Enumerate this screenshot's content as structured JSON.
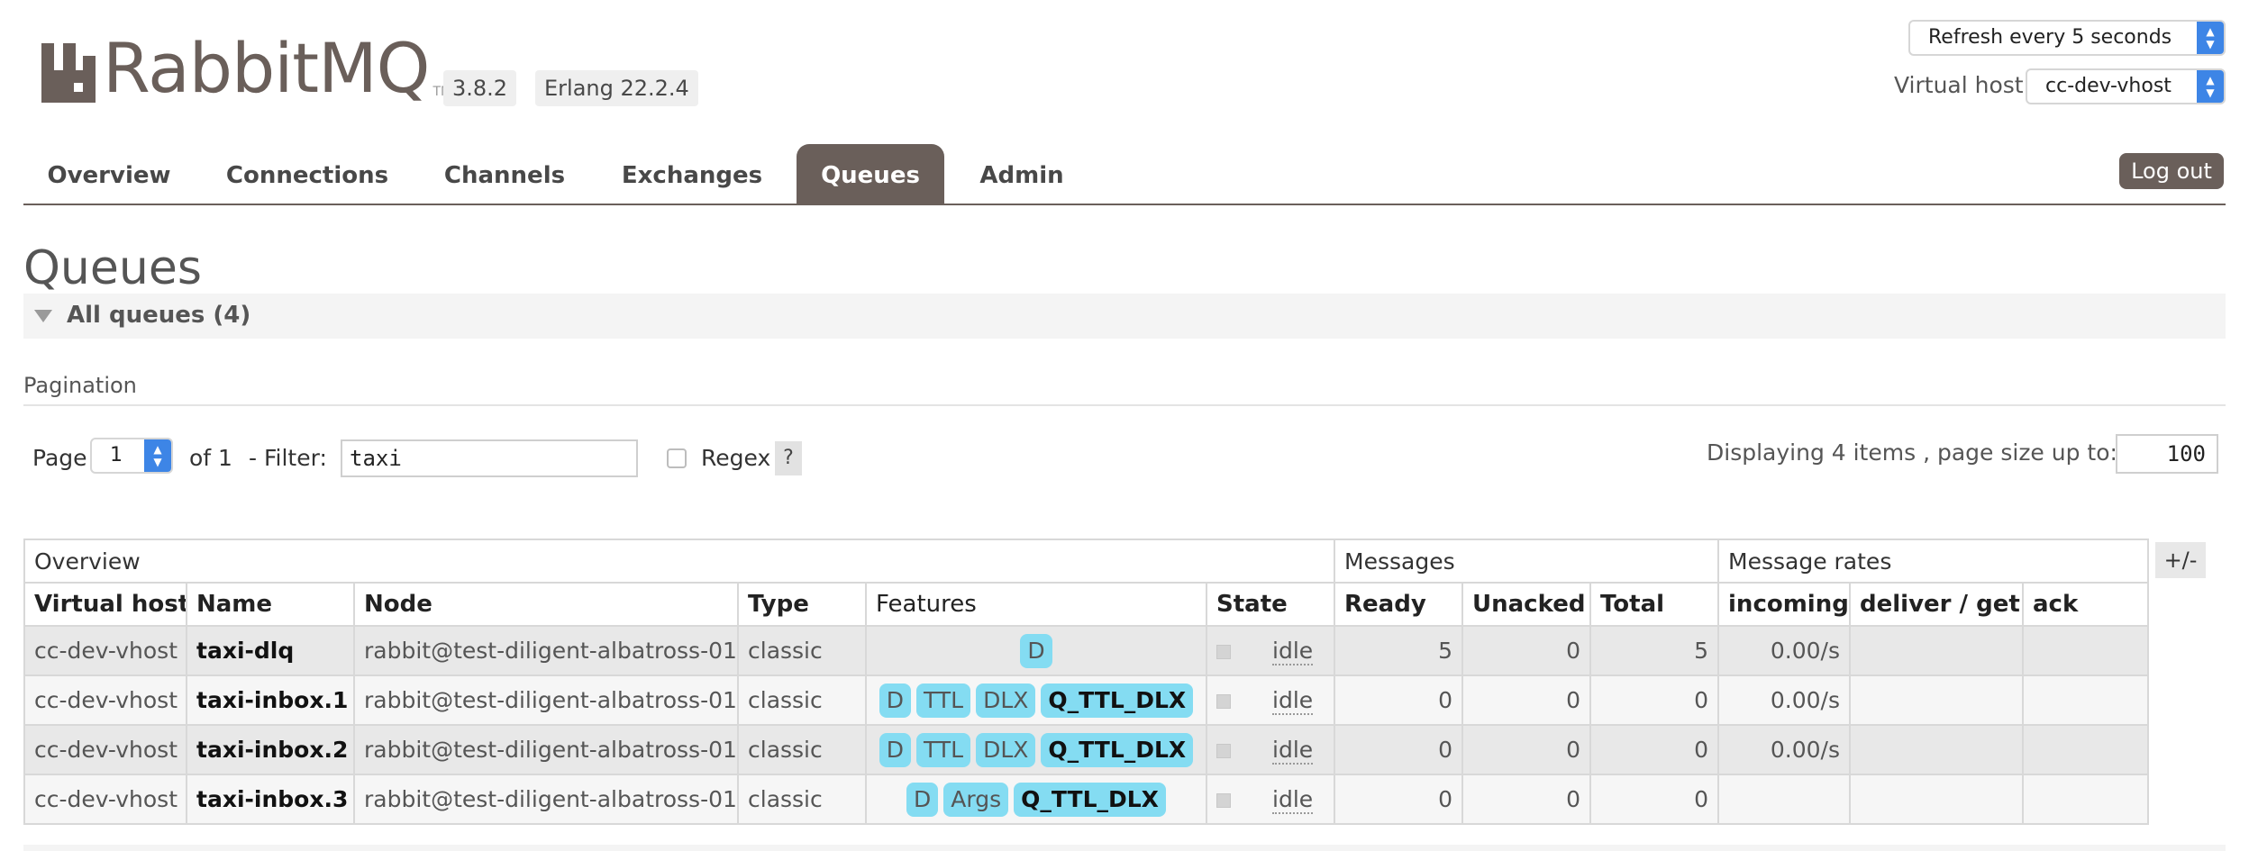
{
  "app": {
    "logo_text": "RabbitMQ",
    "logo_tm": "TM",
    "version": "3.8.2",
    "erlang": "Erlang 22.2.4",
    "refresh_select": "Refresh every 5 seconds",
    "vhost_label": "Virtual host",
    "vhost_select": "cc-dev-vhost",
    "logout": "Log out"
  },
  "nav": {
    "tabs": [
      {
        "label": "Overview",
        "active": false
      },
      {
        "label": "Connections",
        "active": false
      },
      {
        "label": "Channels",
        "active": false
      },
      {
        "label": "Exchanges",
        "active": false
      },
      {
        "label": "Queues",
        "active": true
      },
      {
        "label": "Admin",
        "active": false
      }
    ]
  },
  "page": {
    "title": "Queues",
    "section": "All queues (4)"
  },
  "pagination": {
    "label": "Pagination",
    "page_label": "Page",
    "page_value": "1",
    "of_label": "of 1",
    "filter_label": "- Filter:",
    "filter_value": "taxi",
    "regex_label": "Regex",
    "help": "?",
    "display_text": "Displaying 4 items , page size up to:",
    "page_size": "100"
  },
  "table": {
    "groups": [
      "Overview",
      "Messages",
      "Message rates"
    ],
    "plus_minus": "+/-",
    "columns": [
      "Virtual host",
      "Name",
      "Node",
      "Type",
      "Features",
      "State",
      "Ready",
      "Unacked",
      "Total",
      "incoming",
      "deliver / get",
      "ack"
    ],
    "rows": [
      {
        "vhost": "cc-dev-vhost",
        "name": "taxi-dlq",
        "node": "rabbit@test-diligent-albatross-01",
        "type": "classic",
        "features": [
          {
            "text": "D",
            "strong": false
          }
        ],
        "state": "idle",
        "ready": "5",
        "unacked": "0",
        "total": "5",
        "incoming": "0.00/s",
        "deliver": "",
        "ack": ""
      },
      {
        "vhost": "cc-dev-vhost",
        "name": "taxi-inbox.1",
        "node": "rabbit@test-diligent-albatross-01",
        "type": "classic",
        "features": [
          {
            "text": "D",
            "strong": false
          },
          {
            "text": "TTL",
            "strong": false
          },
          {
            "text": "DLX",
            "strong": false
          },
          {
            "text": "Q_TTL_DLX",
            "strong": true
          }
        ],
        "state": "idle",
        "ready": "0",
        "unacked": "0",
        "total": "0",
        "incoming": "0.00/s",
        "deliver": "",
        "ack": ""
      },
      {
        "vhost": "cc-dev-vhost",
        "name": "taxi-inbox.2",
        "node": "rabbit@test-diligent-albatross-01",
        "type": "classic",
        "features": [
          {
            "text": "D",
            "strong": false
          },
          {
            "text": "TTL",
            "strong": false
          },
          {
            "text": "DLX",
            "strong": false
          },
          {
            "text": "Q_TTL_DLX",
            "strong": true
          }
        ],
        "state": "idle",
        "ready": "0",
        "unacked": "0",
        "total": "0",
        "incoming": "0.00/s",
        "deliver": "",
        "ack": ""
      },
      {
        "vhost": "cc-dev-vhost",
        "name": "taxi-inbox.3",
        "node": "rabbit@test-diligent-albatross-01",
        "type": "classic",
        "features": [
          {
            "text": "D",
            "strong": false
          },
          {
            "text": "Args",
            "strong": false
          },
          {
            "text": "Q_TTL_DLX",
            "strong": true
          }
        ],
        "state": "idle",
        "ready": "0",
        "unacked": "0",
        "total": "0",
        "incoming": "",
        "deliver": "",
        "ack": ""
      }
    ]
  },
  "colors": {
    "brand": "#6a5f5a",
    "feature_tag": "#84dcf2",
    "select_accent": "#3d85e6"
  }
}
